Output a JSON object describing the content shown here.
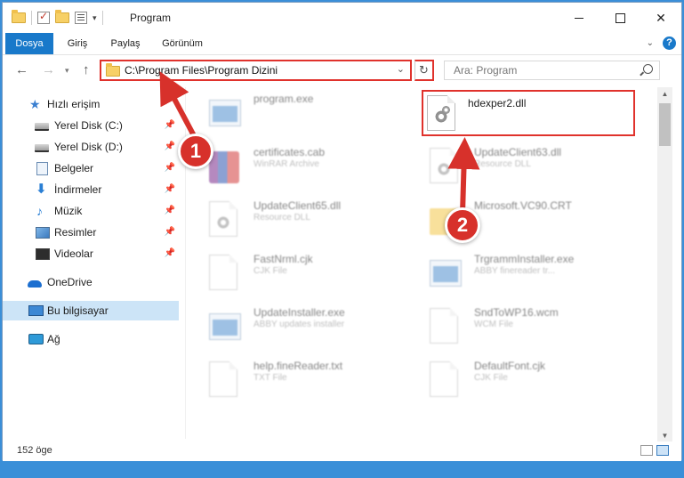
{
  "window": {
    "title": "Program"
  },
  "ribbon": {
    "tabs": [
      "Dosya",
      "Giriş",
      "Paylaş",
      "Görünüm"
    ]
  },
  "address": {
    "path": "C:\\Program Files\\Program Dizini",
    "search_placeholder": "Ara: Program"
  },
  "sidebar": {
    "quick_access": "Hızlı erişim",
    "items": [
      {
        "label": "Yerel Disk (C:)",
        "icon": "drive-icon"
      },
      {
        "label": "Yerel Disk (D:)",
        "icon": "drive-icon"
      },
      {
        "label": "Belgeler",
        "icon": "documents-icon"
      },
      {
        "label": "İndirmeler",
        "icon": "downloads-icon"
      },
      {
        "label": "Müzik",
        "icon": "music-icon"
      },
      {
        "label": "Resimler",
        "icon": "pictures-icon"
      },
      {
        "label": "Videolar",
        "icon": "videos-icon"
      }
    ],
    "onedrive": "OneDrive",
    "this_pc": "Bu bilgisayar",
    "network": "Ağ"
  },
  "files": [
    {
      "name": "program.exe",
      "type": ""
    },
    {
      "name": "hdexper2.dll",
      "type": ""
    },
    {
      "name": "certificates.cab",
      "type": "WinRAR Archive"
    },
    {
      "name": "UpdateClient63.dll",
      "type": "Resource DLL"
    },
    {
      "name": "UpdateClient65.dll",
      "type": "Resource DLL"
    },
    {
      "name": "Microsoft.VC90.CRT",
      "type": ""
    },
    {
      "name": "FastNrml.cjk",
      "type": "CJK File"
    },
    {
      "name": "TrgrammInstaller.exe",
      "type": "ABBY finereader tr..."
    },
    {
      "name": "UpdateInstaller.exe",
      "type": "ABBY updates installer"
    },
    {
      "name": "SndToWP16.wcm",
      "type": "WCM File"
    },
    {
      "name": "help.fineReader.txt",
      "type": "TXT File"
    },
    {
      "name": "DefaultFont.cjk",
      "type": "CJK File"
    }
  ],
  "status": {
    "count": "152 öge"
  },
  "annotations": {
    "step1": "1",
    "step2": "2"
  },
  "colors": {
    "accent": "#1979ca",
    "highlight": "#e0322c",
    "selected": "#cce4f7"
  }
}
